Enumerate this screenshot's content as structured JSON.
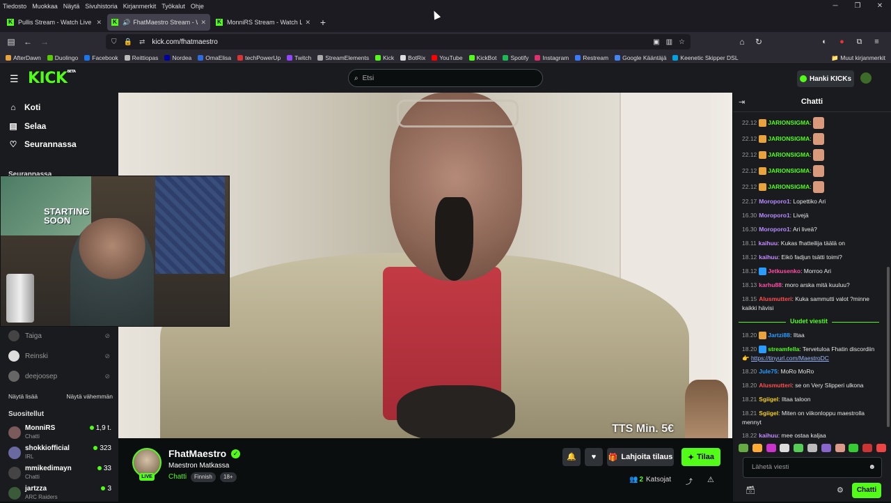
{
  "menubar": {
    "items": [
      "Tiedosto",
      "Muokkaa",
      "Näytä",
      "Sivuhistoria",
      "Kirjanmerkit",
      "Työkalut",
      "Ohje"
    ]
  },
  "tabs": [
    {
      "label": "Pullis Stream - Watch Live o",
      "active": false
    },
    {
      "label": "FhatMaestro Stream - Watc",
      "active": true
    },
    {
      "label": "MonniRS Stream - Watch Li",
      "active": false
    }
  ],
  "url": "kick.com/fhatmaestro",
  "bookmarks": {
    "items": [
      {
        "label": "AfterDawn",
        "color": "#e8a33c"
      },
      {
        "label": "Duolingo",
        "color": "#58cc02"
      },
      {
        "label": "Facebook",
        "color": "#1877f2"
      },
      {
        "label": "Reittiopas",
        "color": "#bbbbbb"
      },
      {
        "label": "Nordea",
        "color": "#0000a0"
      },
      {
        "label": "OmaElisa",
        "color": "#2d6cdf"
      },
      {
        "label": "techPowerUp",
        "color": "#d33"
      },
      {
        "label": "Twitch",
        "color": "#9146ff"
      },
      {
        "label": "StreamElements",
        "color": "#aaaaaa"
      },
      {
        "label": "Kick",
        "color": "#53fc18"
      },
      {
        "label": "BotRix",
        "color": "#dddddd"
      },
      {
        "label": "YouTube",
        "color": "#ff0000"
      },
      {
        "label": "KickBot",
        "color": "#53fc18"
      },
      {
        "label": "Spotify",
        "color": "#1db954"
      },
      {
        "label": "Instagram",
        "color": "#e1306c"
      },
      {
        "label": "Restream",
        "color": "#3a7bfd"
      },
      {
        "label": "Google Kääntäjä",
        "color": "#4285f4"
      },
      {
        "label": "Keenetic Skipper DSL",
        "color": "#00a3e0"
      }
    ],
    "other": "Muut kirjanmerkit"
  },
  "header": {
    "logo": "KICK",
    "logo_badge": "BETA",
    "search_placeholder": "Etsi",
    "kicks_button": "Hanki KICKs"
  },
  "sidebar": {
    "nav": [
      {
        "label": "Koti",
        "icon": "home-icon"
      },
      {
        "label": "Selaa",
        "icon": "browse-icon"
      },
      {
        "label": "Seurannassa",
        "icon": "heart-icon"
      }
    ],
    "following_title": "Seurannassa",
    "following": [
      "Taiga",
      "Reinski",
      "deejoosep"
    ],
    "show_more": "Näytä lisää",
    "show_less": "Näytä vähemmän",
    "recommended_title": "Suositellut",
    "recommended": [
      {
        "name": "MonniRS",
        "category": "Chatti",
        "viewers": "1,9 t."
      },
      {
        "name": "shokkiofficial",
        "category": "IRL",
        "viewers": "323"
      },
      {
        "name": "mmikedimayn",
        "category": "Chatti",
        "viewers": "33"
      },
      {
        "name": "jartzza",
        "category": "ARC Raiders",
        "viewers": "3"
      }
    ]
  },
  "video": {
    "overlay_text": "TTS Min. 5€",
    "webcam_poster": "STARTING SOON"
  },
  "stream": {
    "name": "FhatMaestro",
    "live_label": "LIVE",
    "title": "Maestron Matkassa",
    "category": "Chatti",
    "tags": [
      "Finnish",
      "18+"
    ],
    "gift_button": "Lahjoita tilaus",
    "subscribe_button": "Tilaa",
    "viewers": "2",
    "viewers_label": "Katsojat"
  },
  "chat": {
    "title": "Chatti",
    "new_messages": "Uudet viestit",
    "messages": [
      {
        "time": "22.12",
        "user": "JARIONSIGMA",
        "color": "#53fc18",
        "text": "",
        "emote": true,
        "badge": "#e8a33c"
      },
      {
        "time": "22.12",
        "user": "JARIONSIGMA",
        "color": "#53fc18",
        "text": "",
        "emote": true,
        "badge": "#e8a33c"
      },
      {
        "time": "22.12",
        "user": "JARIONSIGMA",
        "color": "#53fc18",
        "text": "",
        "emote": true,
        "badge": "#e8a33c"
      },
      {
        "time": "22.12",
        "user": "JARIONSIGMA",
        "color": "#53fc18",
        "text": "",
        "emote": true,
        "badge": "#e8a33c"
      },
      {
        "time": "22.12",
        "user": "JARIONSIGMA",
        "color": "#53fc18",
        "text": "",
        "emote": true,
        "badge": "#e8a33c"
      },
      {
        "time": "22.17",
        "user": "Moroporo1",
        "color": "#b78cff",
        "text": "Lopettiko Ari"
      },
      {
        "time": "16.30",
        "user": "Moroporo1",
        "color": "#b78cff",
        "text": "Livejä"
      },
      {
        "time": "16.30",
        "user": "Moroporo1",
        "color": "#b78cff",
        "text": "Ari liveä?"
      },
      {
        "time": "18.11",
        "user": "kaihuu",
        "color": "#c38cff",
        "text": "Kukas fhatteilija täälä on"
      },
      {
        "time": "18.12",
        "user": "kaihuu",
        "color": "#c38cff",
        "text": "Eikö fadjun tsätti toimi?"
      },
      {
        "time": "18.12",
        "user": "Jetkusenko",
        "color": "#ff4fa3",
        "text": "Morroo Ari",
        "badge": "#2a9cff"
      },
      {
        "time": "18.13",
        "user": "karhu88",
        "color": "#ff4fa3",
        "text": "moro arska mitä kuuluu?"
      },
      {
        "time": "18.15",
        "user": "Alusmutteri",
        "color": "#ff4f4f",
        "text": "Kuka sammutti valot ?minne kaikki hävisi"
      }
    ],
    "new_msgs": [
      {
        "time": "18.20",
        "user": "Jartzi88",
        "color": "#2a9cff",
        "text": "Iltaa",
        "badge": "#e8a33c"
      },
      {
        "time": "18.20",
        "user": "streamfella",
        "color": "#53fc18",
        "text": "Tervetuloa Fhatin discordiin 👉 ",
        "link": "https://tinyurl.com/MaestroDC",
        "badge": "#2a9cff"
      },
      {
        "time": "18.20",
        "user": "Jule75",
        "color": "#2a9cff",
        "text": "MoRo MoRo"
      },
      {
        "time": "18.20",
        "user": "Alusmutteri",
        "color": "#ff4f4f",
        "text": "se on Very Slipperi ulkona"
      },
      {
        "time": "18.21",
        "user": "Sgiigel",
        "color": "#f5d020",
        "text": "Iltaa taloon"
      },
      {
        "time": "18.21",
        "user": "Sgiigel",
        "color": "#f5d020",
        "text": "Miten on viikonloppu maestrolla mennyt"
      },
      {
        "time": "18.22",
        "user": "kaihuu",
        "color": "#c38cff",
        "text": "mee ostaa kaljaa"
      }
    ],
    "input_placeholder": "Lähetä viesti",
    "send_button": "Chatti"
  }
}
